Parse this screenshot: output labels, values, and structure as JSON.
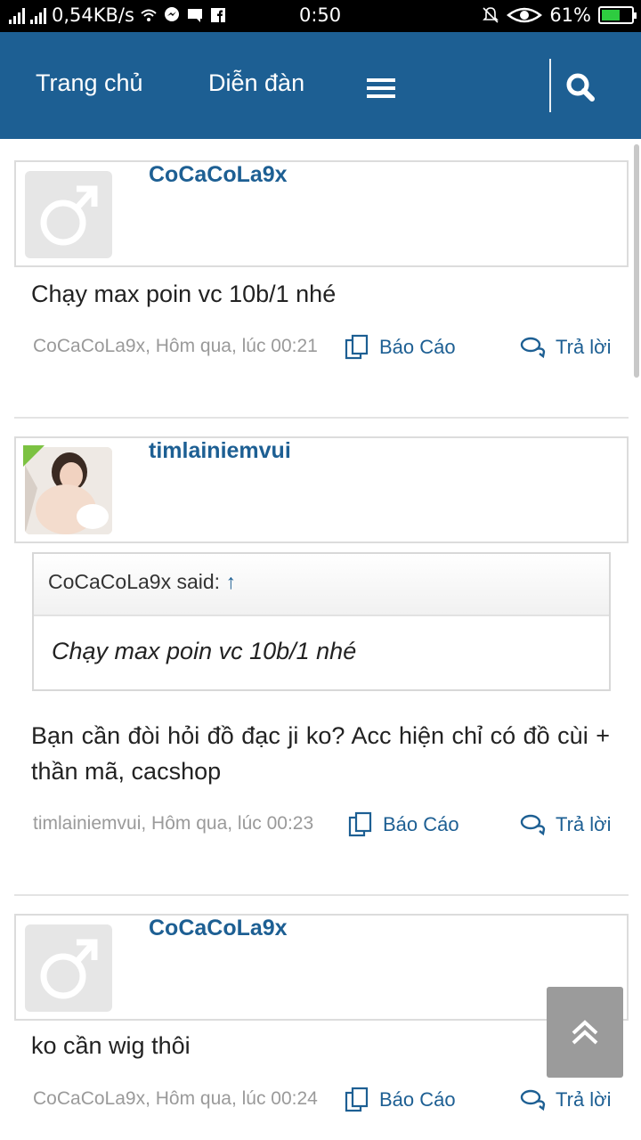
{
  "status_bar": {
    "network_speed": "0,54KB/s",
    "time": "0:50",
    "battery": "61%",
    "battery_level": 0.61
  },
  "nav": {
    "home": "Trang chủ",
    "forum": "Diễn đàn"
  },
  "posts": [
    {
      "username": "CoCaCoLa9x",
      "message": "Chạy max poin vc 10b/1 nhé",
      "meta": "CoCaCoLa9x, Hôm qua, lúc 00:21",
      "report": "Báo Cáo",
      "reply": "Trả lời"
    },
    {
      "username": "timlainiemvui",
      "quote": {
        "author": "CoCaCoLa9x said:",
        "arrow": "↑",
        "text": "Chạy max poin vc 10b/1 nhé"
      },
      "message": "Bạn cần đòi hỏi đồ đạc ji ko? Acc hiện chỉ có đồ cùi + thần mã, cacshop",
      "meta": "timlainiemvui, Hôm qua, lúc 00:23",
      "report": "Báo Cáo",
      "reply": "Trả lời"
    },
    {
      "username": "CoCaCoLa9x",
      "message": "ko cần wig thôi",
      "meta": "CoCaCoLa9x, Hôm qua, lúc 00:24",
      "report": "Báo Cáo",
      "reply": "Trả lời"
    }
  ],
  "colors": {
    "brand": "#1d5f93",
    "status_bar": "#000000",
    "meta_text": "#9a9a9a"
  }
}
